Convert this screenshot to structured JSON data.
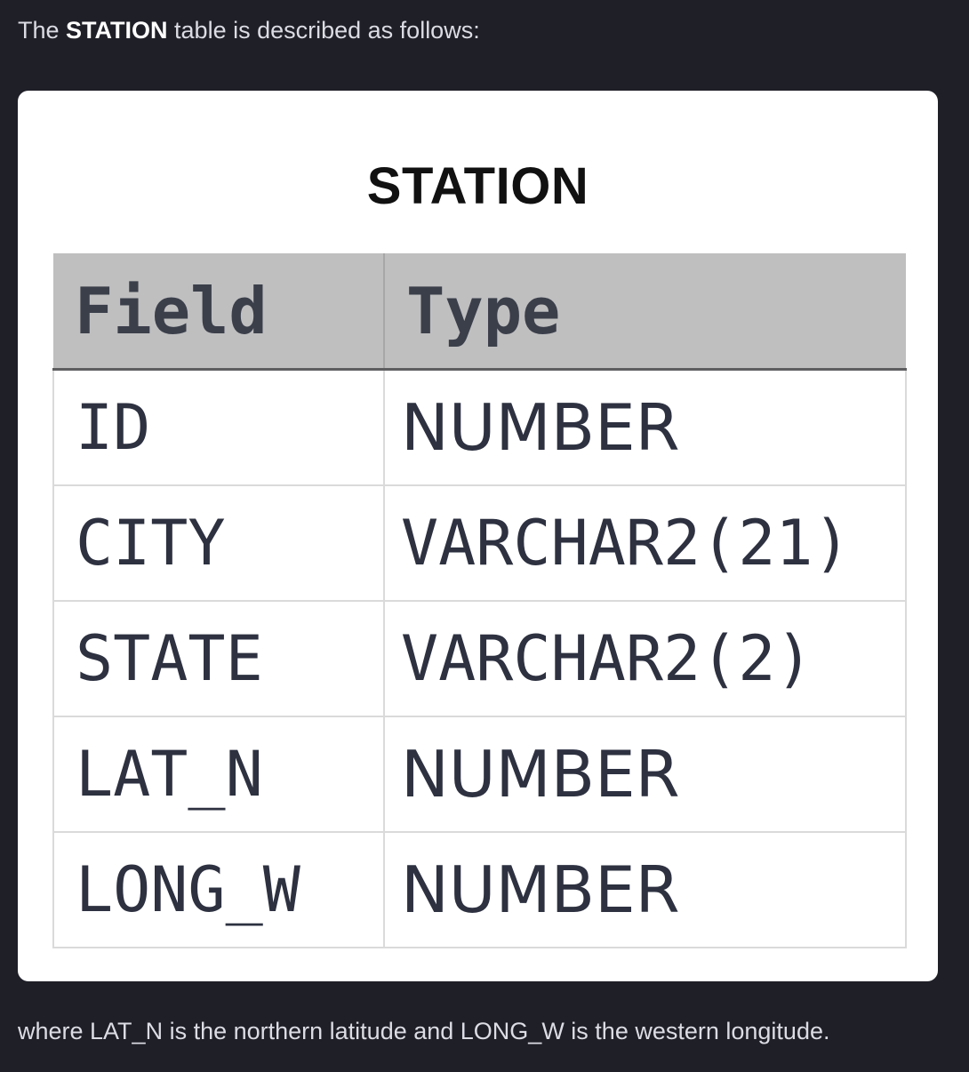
{
  "intro": {
    "prefix": "The ",
    "table_name": "STATION",
    "suffix": " table is described as follows:"
  },
  "table": {
    "title": "STATION",
    "headers": {
      "field": "Field",
      "type": "Type"
    },
    "rows": [
      {
        "field": "ID",
        "type": "NUMBER"
      },
      {
        "field": "CITY",
        "type": "VARCHAR2(21)"
      },
      {
        "field": "STATE",
        "type": "VARCHAR2(2)"
      },
      {
        "field": "LAT_N",
        "type": "NUMBER"
      },
      {
        "field": "LONG_W",
        "type": "NUMBER"
      }
    ]
  },
  "outro": {
    "text": "where LAT_N is the northern latitude and LONG_W is the western longitude."
  },
  "colors": {
    "page_background": "#1f1f28",
    "card_background": "#ffffff",
    "header_background": "#bfbfc0"
  }
}
